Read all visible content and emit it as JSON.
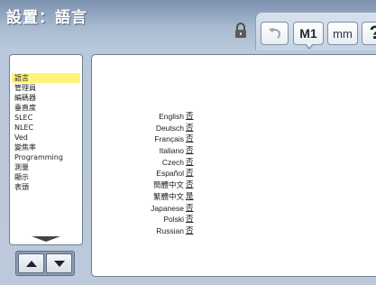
{
  "title": "設置：語言",
  "toolbar": {
    "lock_icon": "lock-icon",
    "undo_icon": "undo-icon",
    "m1_label": "M1",
    "units_label": "mm",
    "help_label": "?"
  },
  "sidebar": {
    "items": [
      {
        "label": "語言",
        "selected": true
      },
      {
        "label": "管理員",
        "selected": false
      },
      {
        "label": "編碼器",
        "selected": false
      },
      {
        "label": "垂直度",
        "selected": false
      },
      {
        "label": "SLEC",
        "selected": false
      },
      {
        "label": "NLEC",
        "selected": false
      },
      {
        "label": "Ved",
        "selected": false
      },
      {
        "label": "變焦率",
        "selected": false
      },
      {
        "label": "Programming",
        "selected": false
      },
      {
        "label": "測量",
        "selected": false
      },
      {
        "label": "顯示",
        "selected": false
      },
      {
        "label": "表頭",
        "selected": false
      }
    ],
    "more_indicator": "scroll-more-icon"
  },
  "scroll": {
    "up_icon": "arrow-up-icon",
    "down_icon": "arrow-down-icon"
  },
  "languages": [
    {
      "name": "English",
      "value": "否"
    },
    {
      "name": "Deutsch",
      "value": "否"
    },
    {
      "name": "Français",
      "value": "否"
    },
    {
      "name": "Italiano",
      "value": "否"
    },
    {
      "name": "Czech",
      "value": "否"
    },
    {
      "name": "Español",
      "value": "否"
    },
    {
      "name": "簡體中文",
      "value": "否"
    },
    {
      "name": "繁體中文",
      "value": "是"
    },
    {
      "name": "Japanese",
      "value": "否"
    },
    {
      "name": "Polski",
      "value": "否"
    },
    {
      "name": "Russian",
      "value": "否"
    }
  ]
}
